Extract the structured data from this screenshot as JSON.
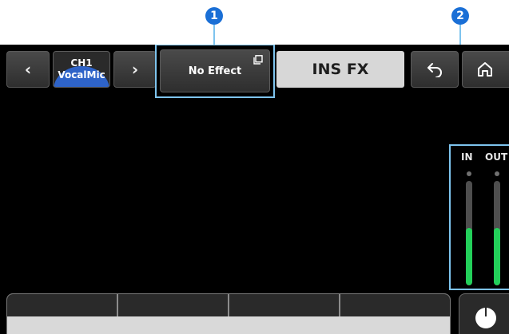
{
  "callouts": [
    "1",
    "2"
  ],
  "nav": {
    "prev_label": "‹",
    "next_label": "›",
    "channel": {
      "number": "CH1",
      "name": "VocalMic",
      "color": "#2e63c8"
    }
  },
  "effect": {
    "label": "No Effect"
  },
  "page_title": "INS FX",
  "meters": {
    "in_label": "IN",
    "out_label": "OUT",
    "fill_color": "#23d05a",
    "in_level": 0.55,
    "out_level": 0.55
  },
  "icons": {
    "copy": "copy-icon",
    "back": "back-arrow-icon",
    "home": "home-icon",
    "knob": "knob-icon"
  }
}
